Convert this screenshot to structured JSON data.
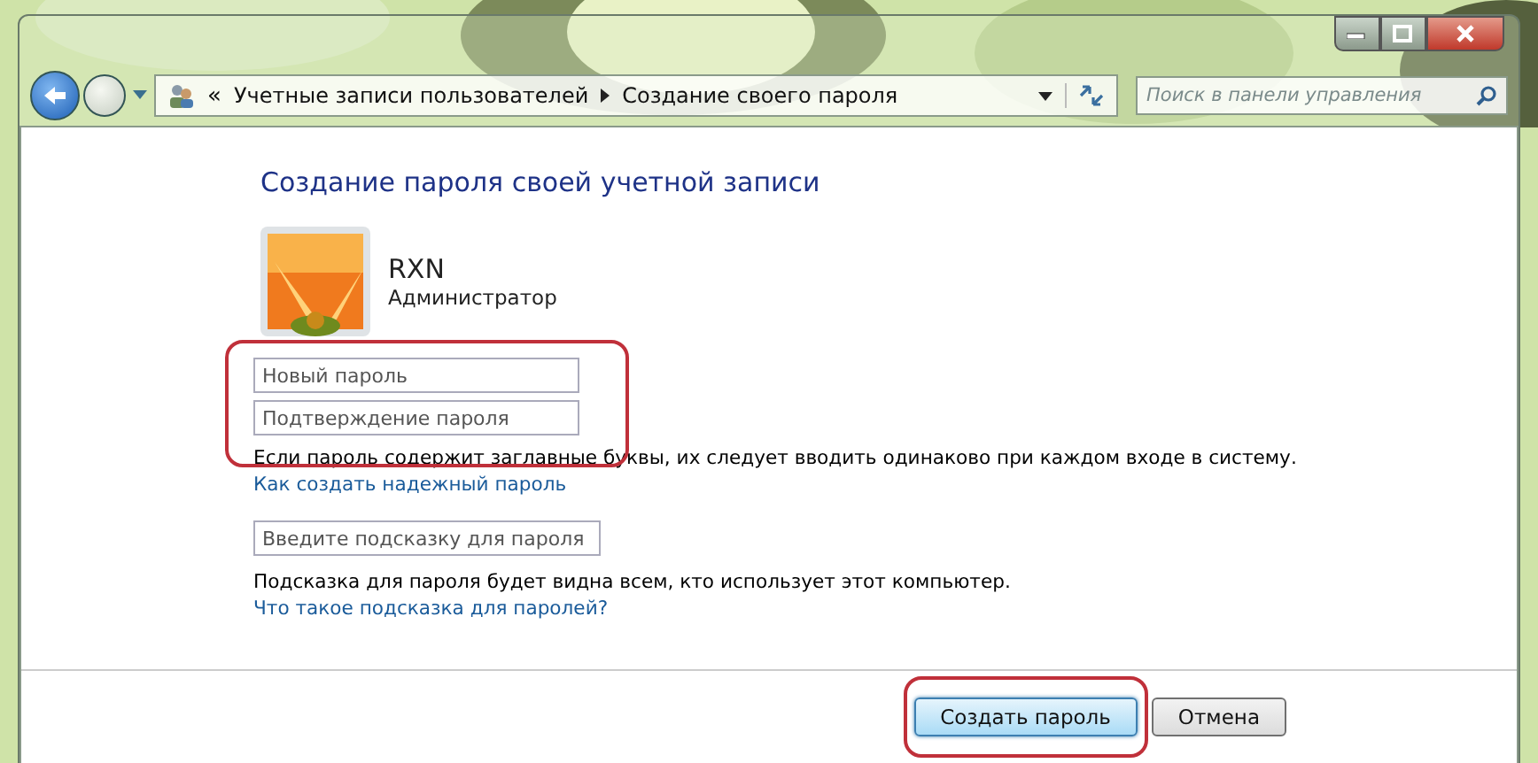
{
  "address_bar": {
    "chevron": "«",
    "crumbs": [
      "Учетные записи пользователей",
      "Создание своего пароля"
    ]
  },
  "search": {
    "placeholder": "Поиск в панели управления"
  },
  "heading": "Создание пароля своей учетной записи",
  "user": {
    "name": "RXN",
    "role": "Администратор"
  },
  "password_fields": {
    "highlighted": true,
    "fields": [
      {
        "placeholder": "Новый пароль"
      },
      {
        "placeholder": "Подтверждение пароля"
      }
    ]
  },
  "caps_note": "Если пароль содержит заглавные буквы, их следует вводить одинаково при каждом входе в систему.",
  "strong_password_link": "Как создать надежный пароль",
  "hint_field": {
    "placeholder": "Введите подсказку для пароля"
  },
  "hint_note": "Подсказка для пароля будет видна всем, кто использует этот компьютер.",
  "hint_link": "Что такое подсказка для паролей?",
  "buttons": [
    {
      "label": "Создать пароль",
      "kind": "primary",
      "highlighted": true
    },
    {
      "label": "Отмена",
      "kind": "normal",
      "highlighted": false
    }
  ]
}
